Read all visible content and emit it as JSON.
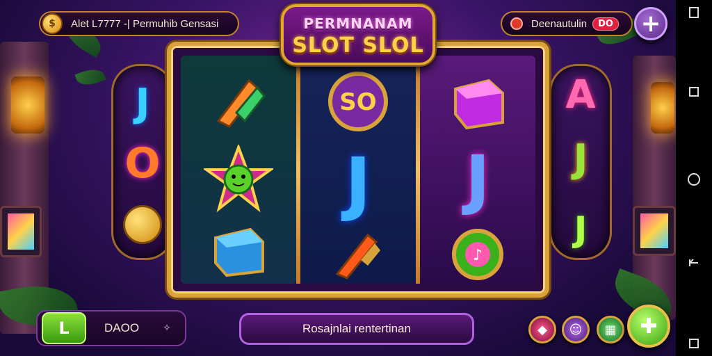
{
  "title": {
    "line1": "PERMNANAM",
    "line2": "SLOT SLOL"
  },
  "top_left": {
    "coin_glyph": "$",
    "text": "Alet L7777 -| Permuhib Gensasi"
  },
  "top_right": {
    "icon": "pin-icon",
    "text": "Deenautulin",
    "badge": "DO",
    "plus": "+"
  },
  "reels": [
    {
      "symbols": [
        "brush",
        "star-face",
        "cube"
      ]
    },
    {
      "symbols": [
        "coin-so",
        "J",
        "brush"
      ]
    },
    {
      "symbols": [
        "cube",
        "J",
        "music-coin"
      ]
    }
  ],
  "side_left": {
    "letters": [
      "J",
      "O"
    ]
  },
  "side_right": {
    "letters": [
      "A",
      "J",
      "J"
    ]
  },
  "bottom": {
    "left_button": "L",
    "bet_value": "DAOO",
    "bet_arrow": "✧",
    "message": "Rosajnlai rentertinan",
    "spin": "✚"
  },
  "colors": {
    "accent_gold": "#d8a33a",
    "purple": "#5a1a7a",
    "green": "#3a9a10"
  }
}
